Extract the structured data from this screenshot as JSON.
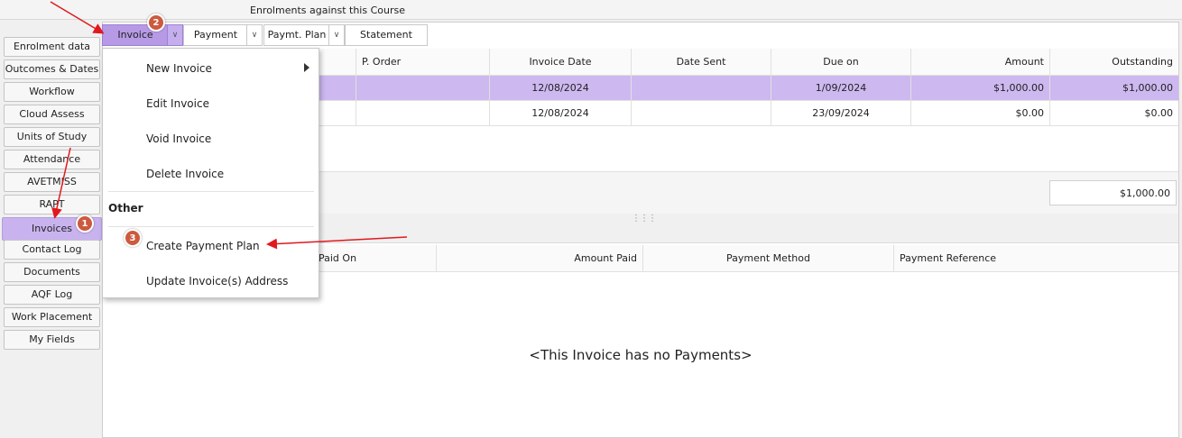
{
  "top_title": "Enrolments against this Course",
  "sidebar": {
    "items": [
      {
        "label": "Enrolment data"
      },
      {
        "label": "Outcomes & Dates"
      },
      {
        "label": "Workflow"
      },
      {
        "label": "Cloud Assess"
      },
      {
        "label": "Units of Study"
      },
      {
        "label": "Attendance"
      },
      {
        "label": "AVETMISS"
      },
      {
        "label": "RAPT"
      },
      {
        "label": "Invoices",
        "active": true
      },
      {
        "label": "Contact Log"
      },
      {
        "label": "Documents"
      },
      {
        "label": "AQF Log"
      },
      {
        "label": "Work Placement"
      },
      {
        "label": "My Fields"
      }
    ]
  },
  "toolbar": {
    "invoice_label": "Invoice",
    "payment_label": "Payment",
    "paymt_plan_label": "Paymt. Plan",
    "statement_label": "Statement"
  },
  "invoices_table": {
    "headers": [
      "P. Order",
      "Invoice Date",
      "Date Sent",
      "Due on",
      "Amount",
      "Outstanding"
    ],
    "rows": [
      [
        "",
        "12/08/2024",
        "",
        "1/09/2024",
        "$1,000.00",
        "$1,000.00"
      ],
      [
        "",
        "12/08/2024",
        "",
        "23/09/2024",
        "$0.00",
        "$0.00"
      ]
    ],
    "total_outstanding": "$1,000.00"
  },
  "payments_table": {
    "headers": [
      "Paid On",
      "Amount Paid",
      "Payment Method",
      "Payment Reference"
    ],
    "empty_message": "<This Invoice has no Payments>"
  },
  "menu": {
    "items": [
      "New Invoice",
      "Edit Invoice",
      "Void Invoice",
      "Delete Invoice"
    ],
    "section": "Other",
    "other_items": [
      "Create Payment Plan",
      "Update Invoice(s) Address"
    ]
  },
  "annotations": {
    "badges": [
      "1",
      "2",
      "3"
    ],
    "color": "#cc5a3e",
    "arrow_color": "#e0191e"
  },
  "colors": {
    "accent_purple": "#b79ae6",
    "selected_row": "#cdb8f0"
  }
}
